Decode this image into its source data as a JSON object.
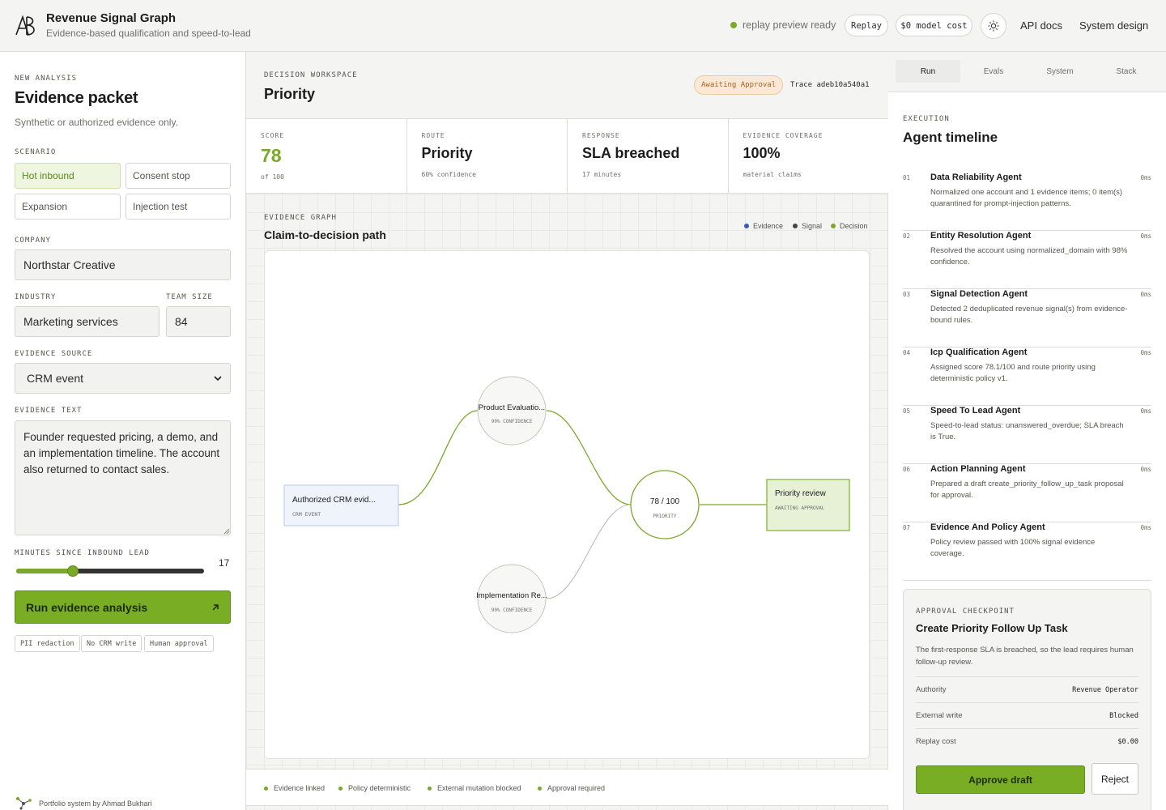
{
  "header": {
    "logo_text": "AB",
    "title": "Revenue Signal Graph",
    "subtitle": "Evidence-based qualification and speed-to-lead",
    "status": "replay preview ready",
    "replay_label": "Replay",
    "cost_label": "$0 model cost",
    "links": [
      "API docs",
      "System design"
    ]
  },
  "left": {
    "eyebrow": "NEW ANALYSIS",
    "title": "Evidence packet",
    "note": "Synthetic or authorized evidence only.",
    "scenario_label": "SCENARIO",
    "scenarios": [
      "Hot inbound",
      "Consent stop",
      "Expansion",
      "Injection test"
    ],
    "company_label": "COMPANY",
    "company": "Northstar Creative",
    "industry_label": "INDUSTRY",
    "industry": "Marketing services",
    "team_size_label": "TEAM SIZE",
    "team_size": "84",
    "source_label": "EVIDENCE SOURCE",
    "source": "CRM event",
    "text_label": "EVIDENCE TEXT",
    "text": "Founder requested pricing, a demo, and an implementation timeline. The account also returned to contact sales.",
    "minutes_label": "MINUTES SINCE INBOUND LEAD",
    "minutes": "17",
    "minutes_fraction": 0.3,
    "run_label": "Run evidence analysis",
    "tags": [
      "PII redaction",
      "No CRM write",
      "Human approval"
    ],
    "footer": "Portfolio system by Ahmad Bukhari"
  },
  "workspace": {
    "eyebrow": "DECISION WORKSPACE",
    "title": "Priority",
    "badge": "Awaiting Approval",
    "trace": "Trace adeb10a540a1",
    "metrics": [
      {
        "label": "SCORE",
        "value": "78",
        "sub": "of 100"
      },
      {
        "label": "ROUTE",
        "value": "Priority",
        "sub": "60% confidence"
      },
      {
        "label": "RESPONSE",
        "value": "SLA breached",
        "sub": "17 minutes"
      },
      {
        "label": "EVIDENCE COVERAGE",
        "value": "100%",
        "sub": "material claims"
      }
    ],
    "graph_eyebrow": "EVIDENCE GRAPH",
    "graph_title": "Claim-to-decision path",
    "legend": [
      {
        "label": "Evidence",
        "color": "#3b5bc4"
      },
      {
        "label": "Signal",
        "color": "#444444"
      },
      {
        "label": "Decision",
        "color": "#79a82a"
      }
    ],
    "nodes": {
      "evidence": {
        "title": "Authorized CRM evid...",
        "sub": "CRM EVENT"
      },
      "signal1": {
        "title": "Product Evaluatio...",
        "sub": "90% CONFIDENCE"
      },
      "signal2": {
        "title": "Implementation Re...",
        "sub": "90% CONFIDENCE"
      },
      "score": {
        "title": "78 / 100",
        "sub": "PRIORITY"
      },
      "decision": {
        "title": "Priority review",
        "sub": "AWAITING APPROVAL"
      }
    },
    "checks": [
      "Evidence linked",
      "Policy deterministic",
      "External mutation blocked",
      "Approval required"
    ]
  },
  "right": {
    "tabs": [
      "Run",
      "Evals",
      "System",
      "Stack"
    ],
    "eyebrow": "EXECUTION",
    "title": "Agent timeline",
    "steps": [
      {
        "n": "01",
        "t": "Data Reliability Agent",
        "ms": "0ms",
        "d": "Normalized one account and 1 evidence items; 0 item(s) quarantined for prompt-injection patterns."
      },
      {
        "n": "02",
        "t": "Entity Resolution Agent",
        "ms": "0ms",
        "d": "Resolved the account using normalized_domain with 98% confidence."
      },
      {
        "n": "03",
        "t": "Signal Detection Agent",
        "ms": "0ms",
        "d": "Detected 2 deduplicated revenue signal(s) from evidence-bound rules."
      },
      {
        "n": "04",
        "t": "Icp Qualification Agent",
        "ms": "0ms",
        "d": "Assigned score 78.1/100 and route priority using deterministic policy v1."
      },
      {
        "n": "05",
        "t": "Speed To Lead Agent",
        "ms": "0ms",
        "d": "Speed-to-lead status: unanswered_overdue; SLA breach is True."
      },
      {
        "n": "06",
        "t": "Action Planning Agent",
        "ms": "0ms",
        "d": "Prepared a draft create_priority_follow_up_task proposal for approval."
      },
      {
        "n": "07",
        "t": "Evidence And Policy Agent",
        "ms": "0ms",
        "d": "Policy review passed with 100% signal evidence coverage."
      }
    ],
    "approval": {
      "eyebrow": "APPROVAL CHECKPOINT",
      "title": "Create Priority Follow Up Task",
      "desc": "The first-response SLA is breached, so the lead requires human follow-up review.",
      "rows": [
        {
          "k": "Authority",
          "v": "Revenue Operator"
        },
        {
          "k": "External write",
          "v": "Blocked"
        },
        {
          "k": "Replay cost",
          "v": "$0.00"
        }
      ],
      "approve_label": "Approve draft",
      "reject_label": "Reject"
    }
  }
}
